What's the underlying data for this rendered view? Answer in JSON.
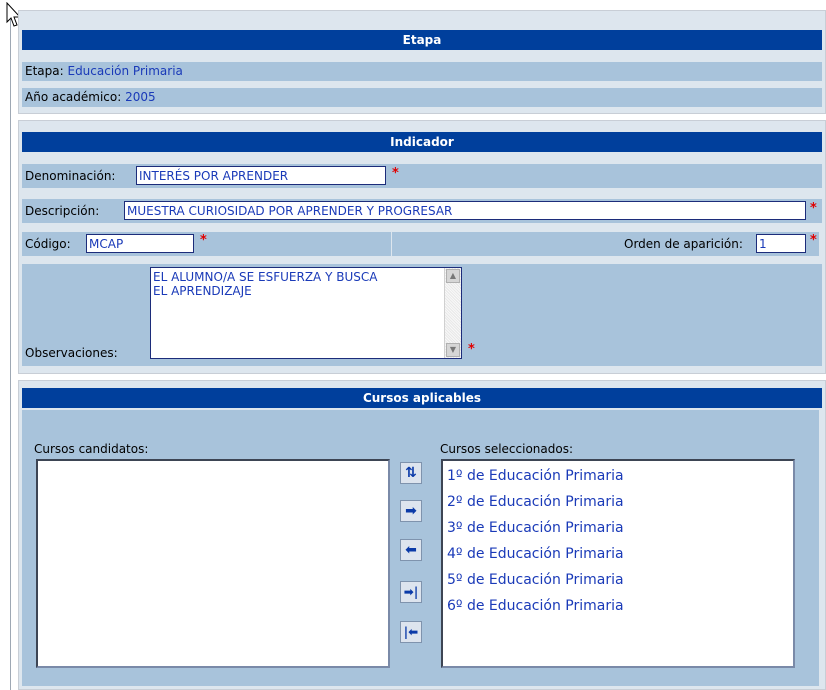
{
  "etapa": {
    "title": "Etapa",
    "etapa_label": "Etapa:",
    "etapa_value": "Educación Primaria",
    "anio_label": "Año académico:",
    "anio_value": "2005"
  },
  "indicador": {
    "title": "Indicador",
    "denominacion_label": "Denominación:",
    "denominacion_value": "INTERÉS POR APRENDER",
    "descripcion_label": "Descripción:",
    "descripcion_value": "MUESTRA CURIOSIDAD POR APRENDER Y PROGRESAR",
    "codigo_label": "Código:",
    "codigo_value": "MCAP",
    "orden_label": "Orden de aparición:",
    "orden_value": "1",
    "observaciones_label": "Observaciones:",
    "observaciones_value": "EL ALUMNO/A SE ESFUERZA Y BUSCA\nEL APRENDIZAJE",
    "required_mark": "*"
  },
  "cursos": {
    "title": "Cursos aplicables",
    "candidatos_label": "Cursos candidatos:",
    "seleccionados_label": "Cursos seleccionados:",
    "candidatos": [],
    "seleccionados": [
      "1º de Educación Primaria",
      "2º de Educación Primaria",
      "3º de Educación Primaria",
      "4º de Educación Primaria",
      "5º de Educación Primaria",
      "6º de Educación Primaria"
    ],
    "buttons": {
      "swap": "⇅",
      "move_right": "➡",
      "move_left": "⬅",
      "move_all_right": "➡|",
      "move_all_left": "|⬅"
    }
  },
  "icons": {
    "cursor": "mouse-pointer-icon",
    "swap": "swap-icon",
    "right": "arrow-right-icon",
    "left": "arrow-left-icon",
    "all_right": "arrow-right-bar-icon",
    "all_left": "arrow-left-bar-icon"
  },
  "colors": {
    "title_bar": "#003f9c",
    "row_bg": "#a8c3db",
    "value_text": "#1a3ab8",
    "required": "#e00000"
  }
}
